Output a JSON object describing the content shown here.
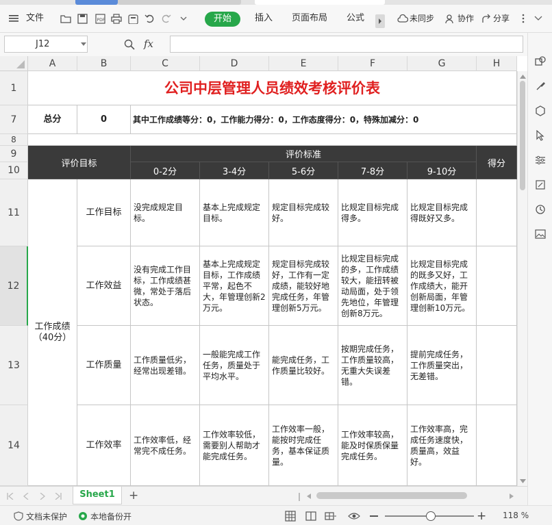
{
  "menubar": {
    "file": "文件",
    "start": "开始",
    "insert": "插入",
    "layout": "页面布局",
    "formula": "公式",
    "unsynced": "未同步",
    "collab": "协作",
    "share": "分享"
  },
  "formula_bar": {
    "cell_ref": "J12",
    "fx": "fx",
    "content": ""
  },
  "columns": [
    "A",
    "B",
    "C",
    "D",
    "E",
    "F",
    "G",
    "H"
  ],
  "rows": [
    "1",
    "7",
    "8",
    "9",
    "10",
    "11",
    "12",
    "13",
    "14"
  ],
  "sheet": {
    "title": "公司中层管理人员绩效考核评价表",
    "total_label": "总分",
    "total_value": "0",
    "summary": "其中工作成绩等分：0，工作能力得分：0，工作态度得分：0，特殊加减分：0",
    "header_target": "评价目标",
    "header_standard": "评价标准",
    "header_score": "得分",
    "ranges": [
      "0-2分",
      "3-4分",
      "5-6分",
      "7-8分",
      "9-10分"
    ],
    "category": "工作成绩（40分）",
    "items": [
      {
        "name": "工作目标",
        "c": "没完成规定目标。",
        "d": "基本上完成规定目标。",
        "e": "规定目标完成较好。",
        "f": "比规定目标完成得多。",
        "g": "比规定目标完成得既好又多。"
      },
      {
        "name": "工作效益",
        "c": "没有完成工作目标，工作成绩甚微，常处于落后状态。",
        "d": "基本上完成规定目标，工作成绩平常，起色不大，年管理创新2万元。",
        "e": "规定目标完成较好，工作有一定成绩，能较好地完成任务，年管理创新5万元。",
        "f": "比规定目标完成的多，工作成绩较大，能扭转被动局面，处于领先地位，年管理创新8万元。",
        "g": "比规定目标完成的既多又好，工作成绩大，能开创新局面，年管理创新10万元。"
      },
      {
        "name": "工作质量",
        "c": "工作质量低劣，经常出现差错。",
        "d": "一般能完成工作任务，质量处于平均水平。",
        "e": "能完成任务，工作质量比较好。",
        "f": "按期完成任务，工作质量较高，无重大失误差错。",
        "g": "提前完成任务，工作质量突出，无差错。"
      },
      {
        "name": "工作效率",
        "c": "工作效率低，经常完不成任务。",
        "d": "工作效率较低，需要别人帮助才能完成任务。",
        "e": "工作效率一般，能按时完成任务，基本保证质量。",
        "f": "工作效率较高，能及时保质保量完成任务。",
        "g": "工作效率高，完成任务速度快，质量高，效益好。"
      }
    ]
  },
  "sheet_tab": "Sheet1",
  "status": {
    "protect": "文档未保护",
    "backup": "本地备份开",
    "zoom": "118 %"
  },
  "colors": {
    "accent_green": "#27a74a",
    "title_red": "#e02020",
    "header_dark": "#3a3a3a"
  }
}
